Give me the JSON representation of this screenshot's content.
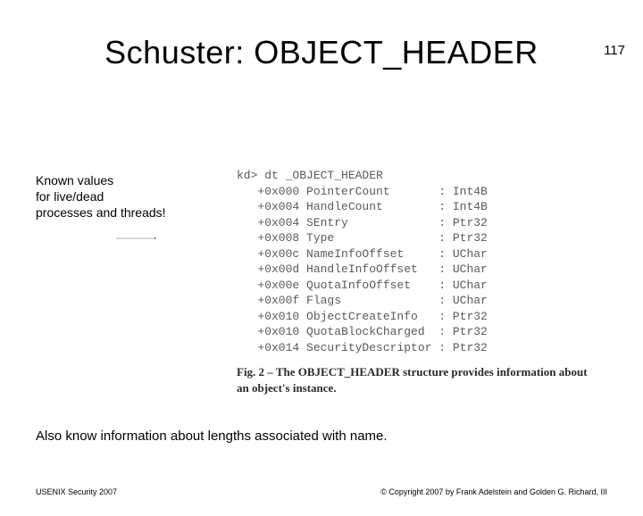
{
  "page_number": "117",
  "title": "Schuster: OBJECT_HEADER",
  "annotation_line1": "Known values",
  "annotation_line2": "for live/dead",
  "annotation_line3": "processes and threads!",
  "code": {
    "header": "kd> dt _OBJECT_HEADER",
    "rows": [
      {
        "offset": "+0x000",
        "field": "PointerCount",
        "type": "Int4B"
      },
      {
        "offset": "+0x004",
        "field": "HandleCount",
        "type": "Int4B"
      },
      {
        "offset": "+0x004",
        "field": "SEntry",
        "type": "Ptr32"
      },
      {
        "offset": "+0x008",
        "field": "Type",
        "type": "Ptr32"
      },
      {
        "offset": "+0x00c",
        "field": "NameInfoOffset",
        "type": "UChar"
      },
      {
        "offset": "+0x00d",
        "field": "HandleInfoOffset",
        "type": "UChar"
      },
      {
        "offset": "+0x00e",
        "field": "QuotaInfoOffset",
        "type": "UChar"
      },
      {
        "offset": "+0x00f",
        "field": "Flags",
        "type": "UChar"
      },
      {
        "offset": "+0x010",
        "field": "ObjectCreateInfo",
        "type": "Ptr32"
      },
      {
        "offset": "+0x010",
        "field": "QuotaBlockCharged",
        "type": "Ptr32"
      },
      {
        "offset": "+0x014",
        "field": "SecurityDescriptor",
        "type": "Ptr32"
      }
    ]
  },
  "figure_caption": "Fig. 2 – The OBJECT_HEADER structure provides information about an object's instance.",
  "bottom_note": "Also know information about lengths associated with name.",
  "footer_left": "USENIX Security 2007",
  "footer_right": "© Copyright 2007 by Frank Adelstein and Golden G. Richard, III"
}
